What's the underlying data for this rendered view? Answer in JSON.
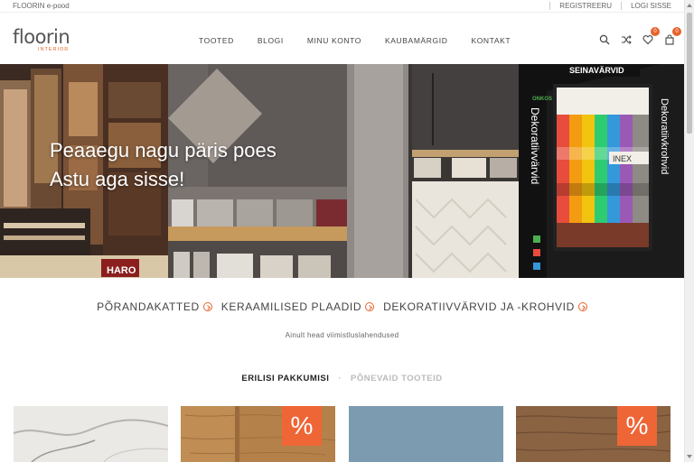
{
  "topbar": {
    "shop_name": "FLOORIN e-pood",
    "register": "REGISTREERU",
    "login": "LOGI SISSE"
  },
  "header": {
    "logo_text": "floorin",
    "logo_sub": "INTERIOR",
    "nav": [
      "TOOTED",
      "BLOGI",
      "MINU KONTO",
      "KAUBAMÄRGID",
      "KONTAKT"
    ],
    "wishlist_count": "0",
    "cart_count": "0"
  },
  "hero": {
    "line1": "Peaaegu nagu päris poes",
    "line2": "Astu aga sisse!",
    "sign_brand": "SEINAVÄRVID",
    "sign_left": "Dekoratiivvärvid",
    "sign_right": "Dekoratiivkrohvid",
    "sign_small": "ONKOS",
    "panel_label": "INEX",
    "box_label": "HARO"
  },
  "categories": [
    {
      "label": "PÕRANDAKATTED"
    },
    {
      "label": "KERAAMILISED PLAADID"
    },
    {
      "label": "DEKORATIIVVÄRVID JA -KROHVID"
    }
  ],
  "tagline": "Ainult head viimistluslahendused",
  "tabs": {
    "active": "ERILISI PAKKUMISI",
    "separator": "·",
    "inactive": "PÕNEVAID TOOTEID"
  },
  "products": [
    {
      "sale": false,
      "sale_label": ""
    },
    {
      "sale": true,
      "sale_label": "%"
    },
    {
      "sale": false,
      "sale_label": ""
    },
    {
      "sale": true,
      "sale_label": "%"
    }
  ],
  "colors": {
    "accent": "#e8622a",
    "sale": "#ee6536"
  },
  "icons": [
    "search-icon",
    "shuffle-icon",
    "heart-icon",
    "cart-icon"
  ]
}
